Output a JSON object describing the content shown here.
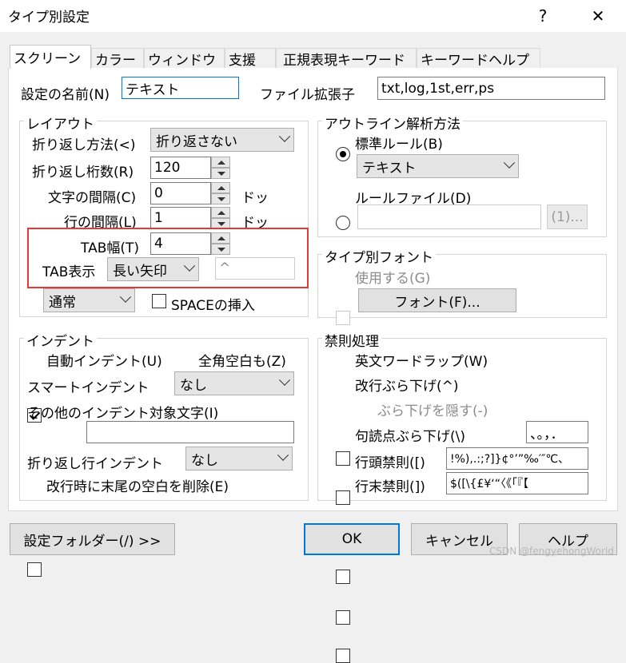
{
  "window": {
    "title": "タイプ別設定",
    "help_glyph": "?",
    "close_glyph": "✕"
  },
  "tabs": [
    {
      "label": "スクリーン",
      "active": true
    },
    {
      "label": "カラー"
    },
    {
      "label": "ウィンドウ"
    },
    {
      "label": "支援"
    },
    {
      "label": "正規表現キーワード"
    },
    {
      "label": "キーワードヘルプ"
    }
  ],
  "settings_name": {
    "label": "設定の名前(N)",
    "value": "テキスト"
  },
  "file_ext": {
    "label": "ファイル拡張子",
    "value": "txt,log,1st,err,ps"
  },
  "layout": {
    "title": "レイアウト",
    "wrap_method": {
      "label": "折り返し方法(<)",
      "value": "折り返さない"
    },
    "wrap_cols": {
      "label": "折り返し桁数(R)",
      "value": "120"
    },
    "char_spacing": {
      "label": "文字の間隔(C)",
      "value": "0",
      "unit": "ドッ"
    },
    "line_spacing": {
      "label": "行の間隔(L)",
      "value": "1",
      "unit": "ドッ"
    },
    "tab_width": {
      "label": "TAB幅(T)",
      "value": "4"
    },
    "tab_display": {
      "label": "TAB表示",
      "value": "長い矢印",
      "char": "^"
    },
    "mode": {
      "value": "通常"
    },
    "space_insert": {
      "label": "SPACEの挿入",
      "checked": false
    }
  },
  "outline": {
    "title": "アウトライン解析方法",
    "standard_rule": {
      "label": "標準ルール(B)",
      "checked": true
    },
    "standard_value": "テキスト",
    "rule_file": {
      "label": "ルールファイル(D)",
      "checked": false
    },
    "browse_label": "(1)..."
  },
  "font": {
    "title": "タイプ別フォント",
    "use": {
      "label": "使用する(G)",
      "checked": false
    },
    "button": "フォント(F)..."
  },
  "indent": {
    "title": "インデント",
    "auto": {
      "label": "自動インデント(U)",
      "checked": true
    },
    "fullwidth": {
      "label": "全角空白も(Z)",
      "checked": true
    },
    "smart": {
      "label": "スマートインデント",
      "value": "なし"
    },
    "other_label": "その他のインデント対象文字(I)",
    "other_value": "",
    "wrap_indent": {
      "label": "折り返し行インデント",
      "value": "なし"
    },
    "trim_trailing": {
      "label": "改行時に末尾の空白を削除(E)",
      "checked": false
    }
  },
  "kinsoku": {
    "title": "禁則処理",
    "word_wrap": {
      "label": "英文ワードラップ(W)",
      "checked": false
    },
    "hang_newline": {
      "label": "改行ぶら下げ(^)",
      "checked": false
    },
    "hide_hang": {
      "label": "ぶら下げを隠す(-)",
      "checked": false
    },
    "punct_hang": {
      "label": "句読点ぶら下げ(\\)",
      "checked": false,
      "value": "、。，．"
    },
    "line_head": {
      "label": "行頭禁則([)",
      "checked": false,
      "value": "!%),.:;?]}¢°’”‰′″℃、"
    },
    "line_end": {
      "label": "行末禁則(])",
      "checked": false,
      "value": "$([\\{£¥‘“〈《「『【"
    }
  },
  "footer": {
    "folder_button": "設定フォルダー(/) >>",
    "ok": "OK",
    "cancel": "キャンセル",
    "help": "ヘルプ",
    "watermark": "CSDN @fengyehongWorld"
  },
  "colors": {
    "highlight_box": "#e53935",
    "focus_border": "#0078d7"
  }
}
